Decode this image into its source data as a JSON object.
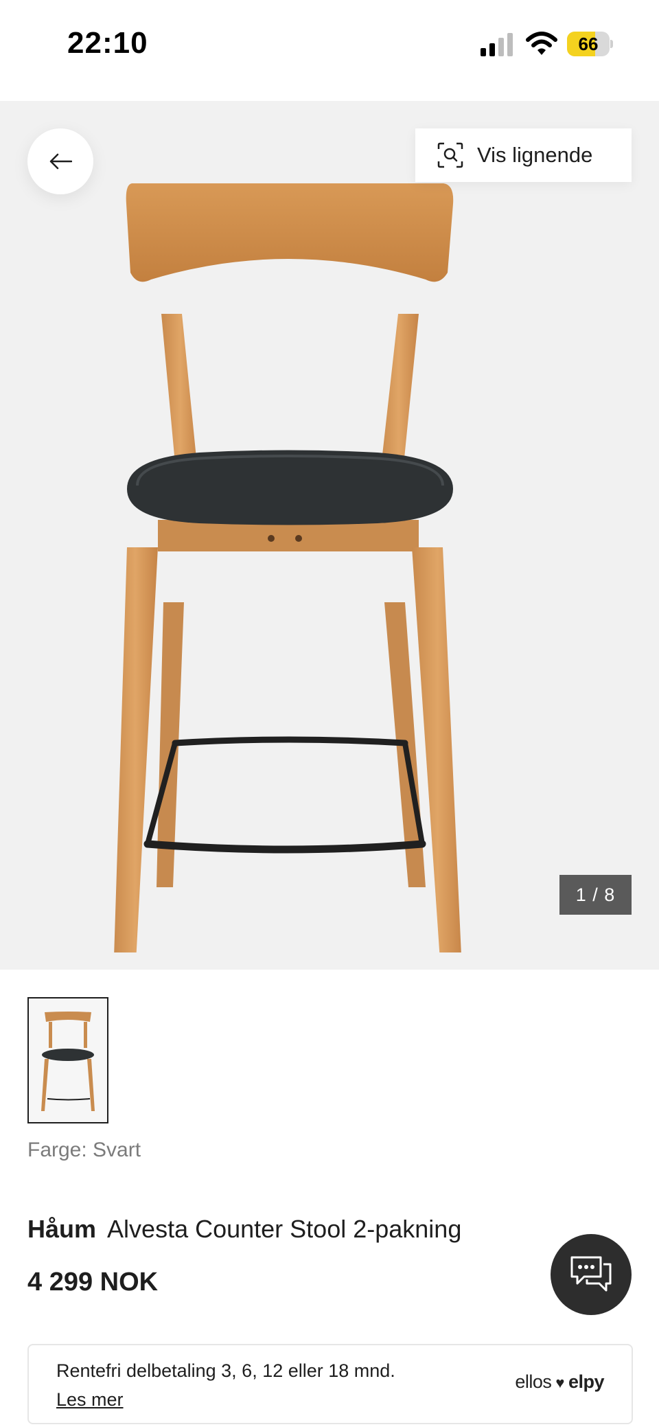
{
  "status_bar": {
    "time": "22:10",
    "battery": "66",
    "battery_level": 0.66,
    "battery_color": "#f4d21f"
  },
  "gallery": {
    "similar_button_label": "Vis lignende",
    "counter": "1 / 8",
    "background": "#f1f1f1"
  },
  "product": {
    "color_label": "Farge: Svart",
    "brand": "Håum",
    "name": "Alvesta Counter Stool 2-pakning",
    "price": "4 299 NOK"
  },
  "payment": {
    "text": "Rentefri delbetaling 3, 6, 12 eller 18 mnd.",
    "link": "Les mer",
    "logo_left": "ellos",
    "logo_heart": "♥",
    "logo_right": "elpy"
  },
  "icons": [
    "signal-icon",
    "wifi-icon",
    "battery-icon",
    "back-arrow-icon",
    "visual-search-icon",
    "chat-icon"
  ]
}
